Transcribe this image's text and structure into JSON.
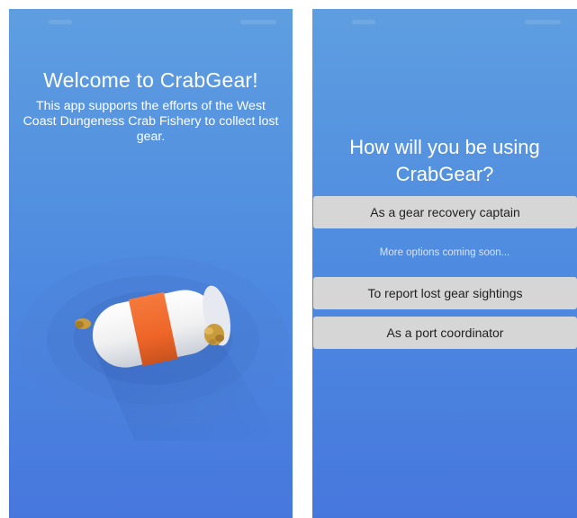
{
  "welcome_screen": {
    "title": "Welcome to CrabGear!",
    "body": "This app supports the efforts of the West Coast Dungeness Crab Fishery to collect lost gear.",
    "image_icon": "crab-buoy-icon",
    "colors": {
      "background_top": "#5e9ee0",
      "background_bottom": "#4777dd",
      "buoy_body": "#f4f4f4",
      "buoy_band": "#f26a2e",
      "rope": "#c89b3c"
    }
  },
  "role_screen": {
    "question": "How will you be using CrabGear?",
    "options": {
      "captain": "As a gear recovery captain",
      "coming_soon": "More options coming soon...",
      "sightings": "To report lost gear sightings",
      "port": "As a port coordinator"
    },
    "colors": {
      "button_bg": "#d6d6d6",
      "button_text": "#1f1f1f",
      "muted_text": "#d5e3f8"
    }
  }
}
